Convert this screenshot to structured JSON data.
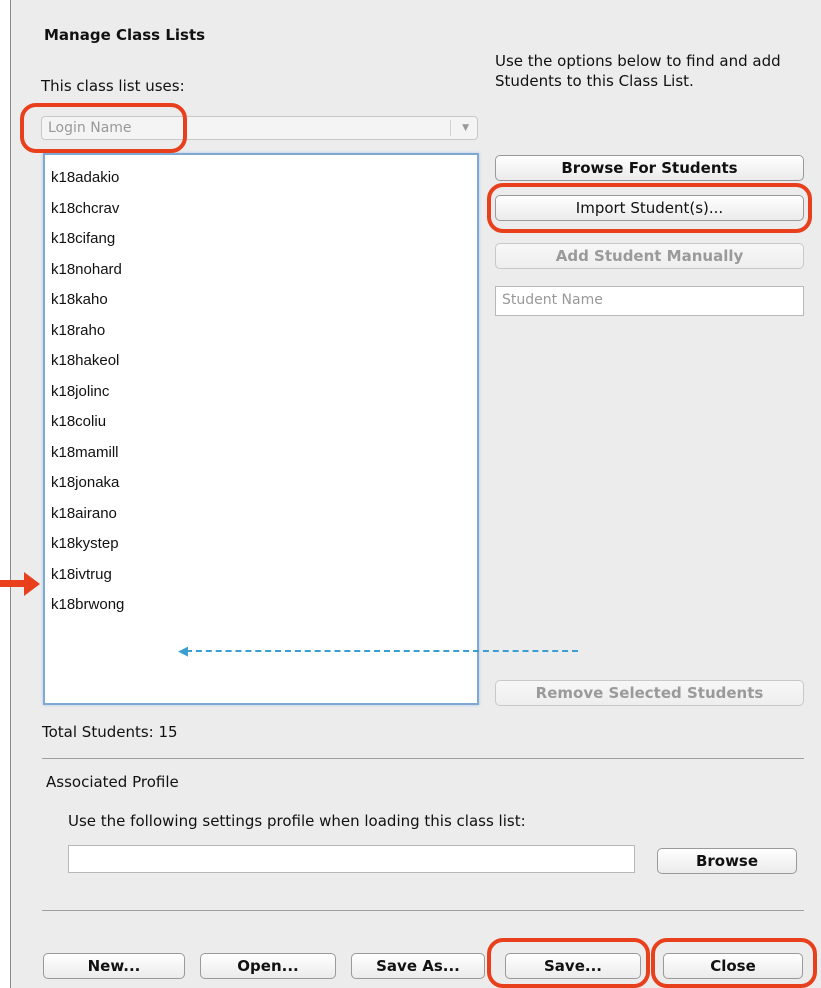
{
  "dialog": {
    "title": "Manage Class Lists",
    "uses_label": "This class list uses:",
    "instructions": "Use the options below to find and add Students to this Class List."
  },
  "id_type_select": {
    "value": "Login Name"
  },
  "students": [
    "k18adakio",
    "k18chcrav",
    "k18cifang",
    "k18nohard",
    "k18kaho",
    "k18raho",
    "k18hakeol",
    "k18jolinc",
    "k18coliu",
    "k18mamill",
    "k18jonaka",
    "k18airano",
    "k18kystep",
    "k18ivtrug",
    "k18brwong"
  ],
  "side_buttons": {
    "browse_students": "Browse For Students",
    "import_students": "Import Student(s)...",
    "add_manually": "Add Student Manually",
    "remove_selected": "Remove Selected Students"
  },
  "student_name_input": {
    "placeholder": "Student Name"
  },
  "total_students": "Total Students: 15",
  "profile": {
    "heading": "Associated Profile",
    "instruction": "Use the following settings profile when loading this class list:",
    "path_value": "",
    "browse_label": "Browse"
  },
  "footer": {
    "new_label": "New...",
    "open_label": "Open...",
    "save_as_label": "Save As...",
    "save_label": "Save...",
    "close_label": "Close"
  },
  "annotation_color": "#e8401c",
  "guide_color": "#3a9fd0"
}
